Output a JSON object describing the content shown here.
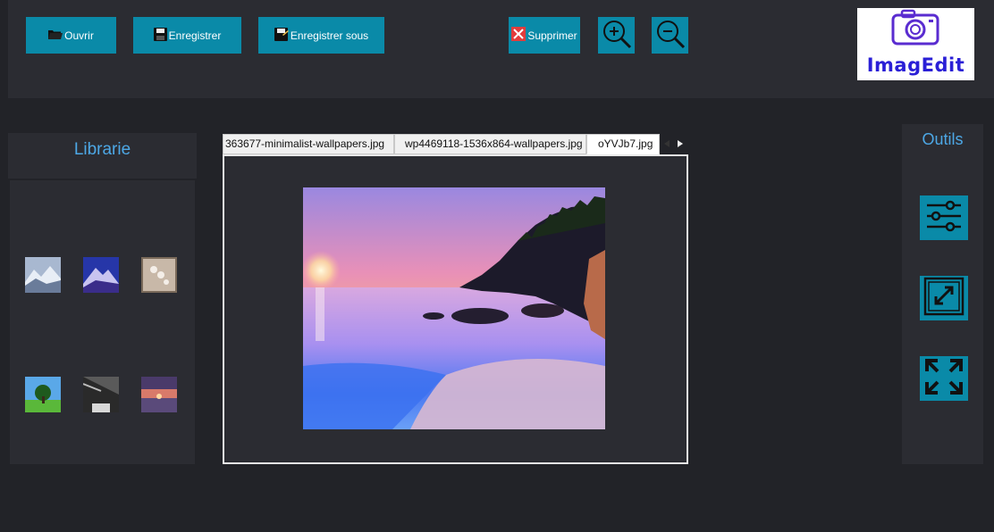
{
  "toolbar": {
    "open_label": "Ouvrir",
    "save_label": "Enregistrer",
    "save_as_label": "Enregistrer sous",
    "delete_label": "Supprimer",
    "zoom_in_icon": "zoom-in-icon",
    "zoom_out_icon": "zoom-out-icon"
  },
  "logo": {
    "text": "ImagEdit",
    "icon": "camera-icon"
  },
  "library": {
    "title": "Librarie",
    "thumbnails": [
      "mountains-snow",
      "mountain-night",
      "pearls",
      "tree-field",
      "building-interior",
      "sunset-sea"
    ]
  },
  "tabs": [
    {
      "label": "363677-minimalist-wallpapers.jpg",
      "active": false
    },
    {
      "label": "wp4469118-1536x864-wallpapers.jpg",
      "active": false
    },
    {
      "label": "oYVJb7.jpg",
      "active": true
    }
  ],
  "tools": {
    "title": "Outils",
    "items": [
      "adjust-sliders-icon",
      "resize-icon",
      "fullscreen-icon"
    ]
  },
  "colors": {
    "accent": "#0a8aa8",
    "panel": "#2b2c32",
    "background": "#222328",
    "heading": "#4da8e6"
  }
}
